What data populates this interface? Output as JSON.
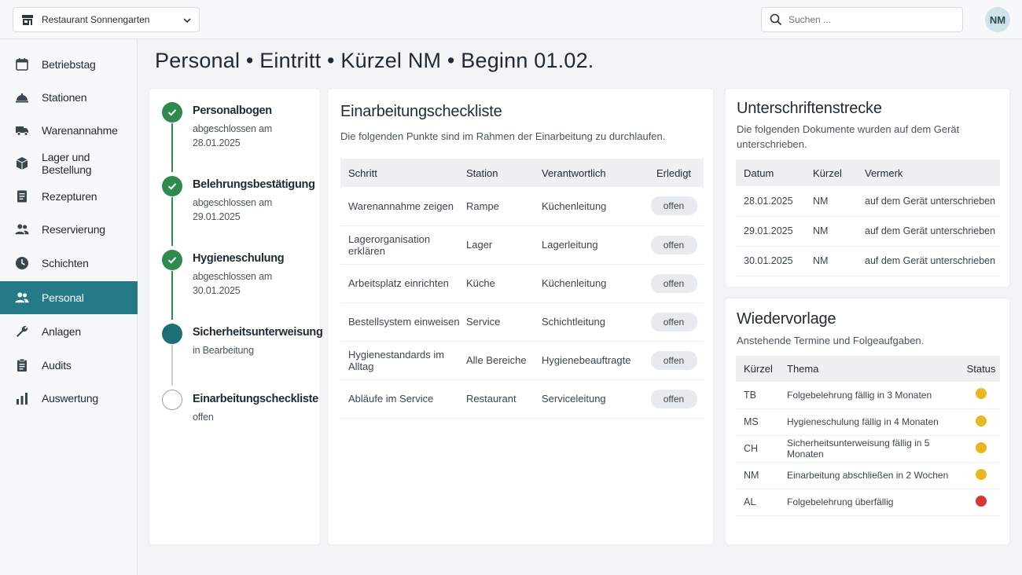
{
  "header": {
    "restaurant": "Restaurant Sonnengarten",
    "search_placeholder": "Suchen ...",
    "avatar_initials": "NM"
  },
  "sidebar": {
    "items": [
      {
        "label": "Betriebstag",
        "icon": "calendar-icon"
      },
      {
        "label": "Stationen",
        "icon": "cloche-icon"
      },
      {
        "label": "Warenannahme",
        "icon": "truck-icon"
      },
      {
        "label": "Lager und Bestellung",
        "icon": "box-icon"
      },
      {
        "label": "Rezepturen",
        "icon": "document-icon"
      },
      {
        "label": "Reservierung",
        "icon": "people-icon"
      },
      {
        "label": "Schichten",
        "icon": "clock-icon"
      },
      {
        "label": "Personal",
        "icon": "people-icon",
        "active": true
      },
      {
        "label": "Anlagen",
        "icon": "wrench-icon"
      },
      {
        "label": "Audits",
        "icon": "clipboard-icon"
      },
      {
        "label": "Auswertung",
        "icon": "bar-chart-icon"
      }
    ]
  },
  "page": {
    "title": "Personal • Eintritt • Kürzel NM • Beginn 01.02."
  },
  "progress": {
    "steps": [
      {
        "title": "Personalbogen",
        "status_line": "abgeschlossen am",
        "date": "28.01.2025",
        "state": "done"
      },
      {
        "title": "Belehrungsbestätigung",
        "status_line": "abgeschlossen am",
        "date": "29.01.2025",
        "state": "done"
      },
      {
        "title": "Hygieneschulung",
        "status_line": "abgeschlossen am",
        "date": "30.01.2025",
        "state": "done"
      },
      {
        "title": "Sicherheitsunterweisung",
        "status_line": "in Bearbeitung",
        "date": "",
        "state": "current"
      },
      {
        "title": "Einarbeitungscheckliste",
        "status_line": "offen",
        "date": "",
        "state": "open"
      }
    ]
  },
  "checklist": {
    "title": "Einarbeitungscheckliste",
    "description": "Die folgenden Punkte sind im Rahmen der Einarbeitung zu durchlaufen.",
    "columns": [
      "Schritt",
      "Station",
      "Verantwortlich",
      "Erledigt"
    ],
    "rows": [
      {
        "step": "Warenannahme zeigen",
        "station": "Rampe",
        "owner": "Küchenleitung",
        "done": "offen"
      },
      {
        "step": "Lagerorganisation erklären",
        "station": "Lager",
        "owner": "Lagerleitung",
        "done": "offen"
      },
      {
        "step": "Arbeitsplatz einrichten",
        "station": "Küche",
        "owner": "Küchenleitung",
        "done": "offen"
      },
      {
        "step": "Bestellsystem einweisen",
        "station": "Service",
        "owner": "Schichtleitung",
        "done": "offen"
      },
      {
        "step": "Hygienestandards im Alltag",
        "station": "Alle Bereiche",
        "owner": "Hygienebeauftragte",
        "done": "offen"
      },
      {
        "step": "Abläufe im Service",
        "station": "Restaurant",
        "owner": "Serviceleitung",
        "done": "offen"
      }
    ]
  },
  "signatures": {
    "title": "Unterschriftenstrecke",
    "description": "Die folgenden Dokumente wurden auf dem Gerät unterschrieben.",
    "columns": [
      "Datum",
      "Kürzel",
      "Vermerk"
    ],
    "rows": [
      {
        "date": "28.01.2025",
        "initials": "NM",
        "note": "auf dem Gerät unterschrieben"
      },
      {
        "date": "29.01.2025",
        "initials": "NM",
        "note": "auf dem Gerät unterschrieben"
      },
      {
        "date": "30.01.2025",
        "initials": "NM",
        "note": "auf dem Gerät unterschrieben"
      }
    ]
  },
  "followups": {
    "title": "Wiedervorlage",
    "description": "Anstehende Termine und Folgeaufgaben.",
    "columns": [
      "Kürzel",
      "Thema",
      "Status"
    ],
    "rows": [
      {
        "initials": "TB",
        "topic": "Folgebelehrung fällig in 3 Monaten",
        "status_color": "#e8b820"
      },
      {
        "initials": "MS",
        "topic": "Hygieneschulung fällig in 4 Monaten",
        "status_color": "#e8b820"
      },
      {
        "initials": "CH",
        "topic": "Sicherheitsunterweisung fällig in 5 Monaten",
        "status_color": "#e8b820"
      },
      {
        "initials": "NM",
        "topic": "Einarbeitung abschließen in 2 Wochen",
        "status_color": "#e8b820"
      },
      {
        "initials": "AL",
        "topic": "Folgebelehrung überfällig",
        "status_color": "#d93636"
      }
    ]
  },
  "colors": {
    "accent": "#247a86",
    "done": "#2f8a4e",
    "current": "#1c6f77",
    "warning": "#e8b820",
    "danger": "#d93636"
  }
}
